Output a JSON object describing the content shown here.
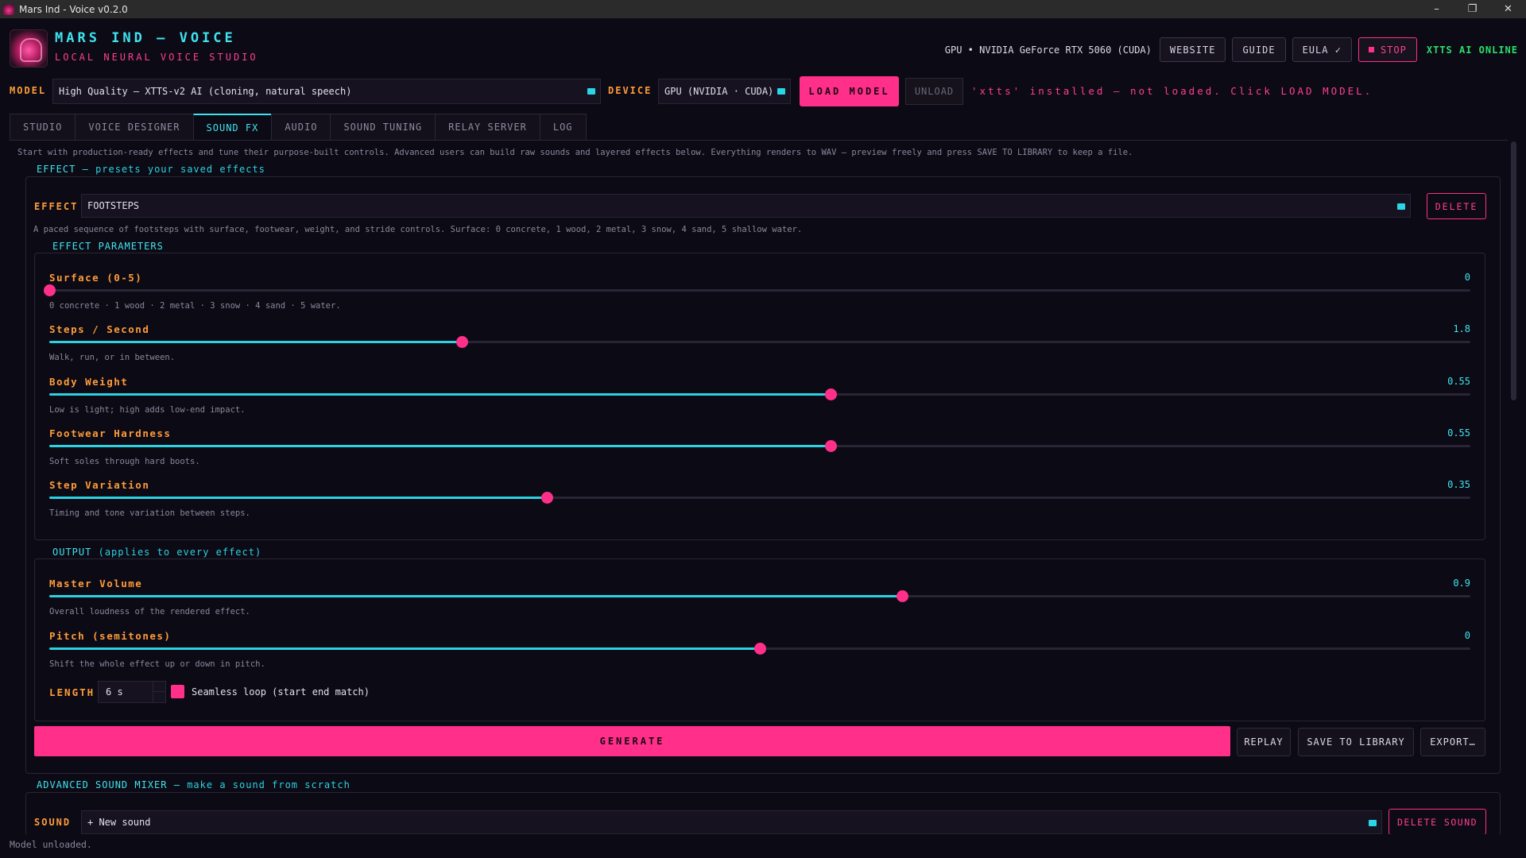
{
  "window": {
    "title": "Mars Ind - Voice v0.2.0",
    "controls": [
      "–",
      "❐",
      "✕"
    ]
  },
  "header": {
    "brand_title": "MARS IND — VOICE",
    "brand_subtitle": "LOCAL NEURAL VOICE STUDIO",
    "gpu_info": "GPU • NVIDIA GeForce RTX 5060 (CUDA)",
    "website_label": "WEBSITE",
    "guide_label": "GUIDE",
    "eula_label": "EULA ✓",
    "stop_label": "STOP",
    "online_label": "XTTS AI ONLINE"
  },
  "model_row": {
    "model_label": "MODEL",
    "model_value": "High Quality — XTTS-v2 AI  (cloning, natural speech)",
    "device_label": "DEVICE",
    "device_value": "GPU (NVIDIA · CUDA)",
    "load_label": "LOAD MODEL",
    "unload_label": "UNLOAD",
    "status_text": "'xtts' installed — not loaded. Click LOAD MODEL."
  },
  "tabs": [
    {
      "label": "STUDIO"
    },
    {
      "label": "VOICE DESIGNER"
    },
    {
      "label": "SOUND FX",
      "active": true
    },
    {
      "label": "AUDIO"
    },
    {
      "label": "SOUND TUNING"
    },
    {
      "label": "RELAY SERVER"
    },
    {
      "label": "LOG"
    }
  ],
  "intro_text": "Start with production-ready effects and tune their purpose-built controls. Advanced users can build raw sounds and layered effects below. Everything renders to WAV — preview freely and press SAVE TO LIBRARY to keep a file.",
  "effect_group": {
    "title_main": "EFFECT",
    "title_dash": "—",
    "title_rest": "presets  your saved effects",
    "effect_label": "EFFECT",
    "effect_value": "FOOTSTEPS",
    "delete_label": "DELETE",
    "description": "A paced sequence of footsteps with surface, footwear, weight, and stride controls. Surface: 0 concrete, 1 wood, 2 metal, 3 snow, 4 sand, 5 shallow water."
  },
  "params_group": {
    "title": "EFFECT PARAMETERS",
    "params": [
      {
        "name": "Surface (0-5)",
        "value": "0",
        "fraction": 0.0,
        "desc": "0 concrete · 1 wood · 2 metal · 3 snow · 4 sand · 5 water."
      },
      {
        "name": "Steps / Second",
        "value": "1.8",
        "fraction": 0.29,
        "desc": "Walk, run, or in between."
      },
      {
        "name": "Body Weight",
        "value": "0.55",
        "fraction": 0.55,
        "desc": "Low is light; high adds low-end impact."
      },
      {
        "name": "Footwear Hardness",
        "value": "0.55",
        "fraction": 0.55,
        "desc": "Soft soles through hard boots."
      },
      {
        "name": "Step Variation",
        "value": "0.35",
        "fraction": 0.35,
        "desc": "Timing and tone variation between steps."
      }
    ]
  },
  "output_group": {
    "title_main": "OUTPUT",
    "title_rest": "(applies to every effect)",
    "params": [
      {
        "name": "Master Volume",
        "value": "0.9",
        "fraction": 0.6,
        "desc": "Overall loudness of the rendered effect."
      },
      {
        "name": "Pitch (semitones)",
        "value": "0",
        "fraction": 0.5,
        "desc": "Shift the whole effect up or down in pitch."
      }
    ],
    "length_label": "LENGTH",
    "length_value": "6 s",
    "loop_label": "Seamless loop (start  end match)"
  },
  "actions": {
    "generate_label": "GENERATE",
    "replay_label": "REPLAY",
    "save_label": "SAVE TO LIBRARY",
    "export_label": "EXPORT…"
  },
  "mixer_group": {
    "title_main": "ADVANCED SOUND MIXER",
    "title_dash": "—",
    "title_rest": "make a sound from scratch",
    "sound_label": "SOUND",
    "sound_value": "+  New sound",
    "delete_sound_label": "DELETE SOUND"
  },
  "status_bar": "Model unloaded.",
  "colors": {
    "accent_pink": "#ff2f8a",
    "accent_cyan": "#3fe3ef",
    "label_orange": "#ff9c3a",
    "online_green": "#29e06a",
    "background": "#0c0a14"
  }
}
